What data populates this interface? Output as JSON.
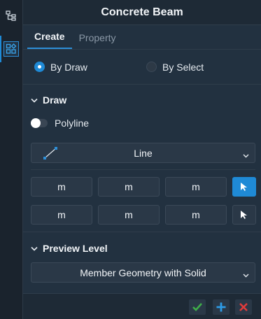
{
  "sidebar": {
    "items": [
      {
        "icon": "tree-icon",
        "active": false
      },
      {
        "icon": "grid-icon",
        "active": true
      }
    ]
  },
  "header": {
    "title": "Concrete Beam"
  },
  "tabs": [
    {
      "label": "Create",
      "active": true
    },
    {
      "label": "Property",
      "active": false
    }
  ],
  "mode": {
    "options": [
      {
        "label": "By Draw",
        "selected": true
      },
      {
        "label": "By Select",
        "selected": false
      }
    ]
  },
  "draw": {
    "title": "Draw",
    "polyline": {
      "label": "Polyline",
      "on": false
    },
    "shape_select": {
      "value": "Line",
      "icon": "line-icon"
    },
    "rows": [
      {
        "units": [
          "m",
          "m",
          "m"
        ],
        "pick_active": true
      },
      {
        "units": [
          "m",
          "m",
          "m"
        ],
        "pick_active": false
      }
    ]
  },
  "preview": {
    "title": "Preview Level",
    "select_value": "Member Geometry with Solid"
  },
  "footer": {
    "actions": [
      "check-icon",
      "plus-icon",
      "close-icon"
    ]
  },
  "colors": {
    "accent": "#1f8ad6",
    "confirm": "#3fae49",
    "cancel": "#e03b3b"
  }
}
